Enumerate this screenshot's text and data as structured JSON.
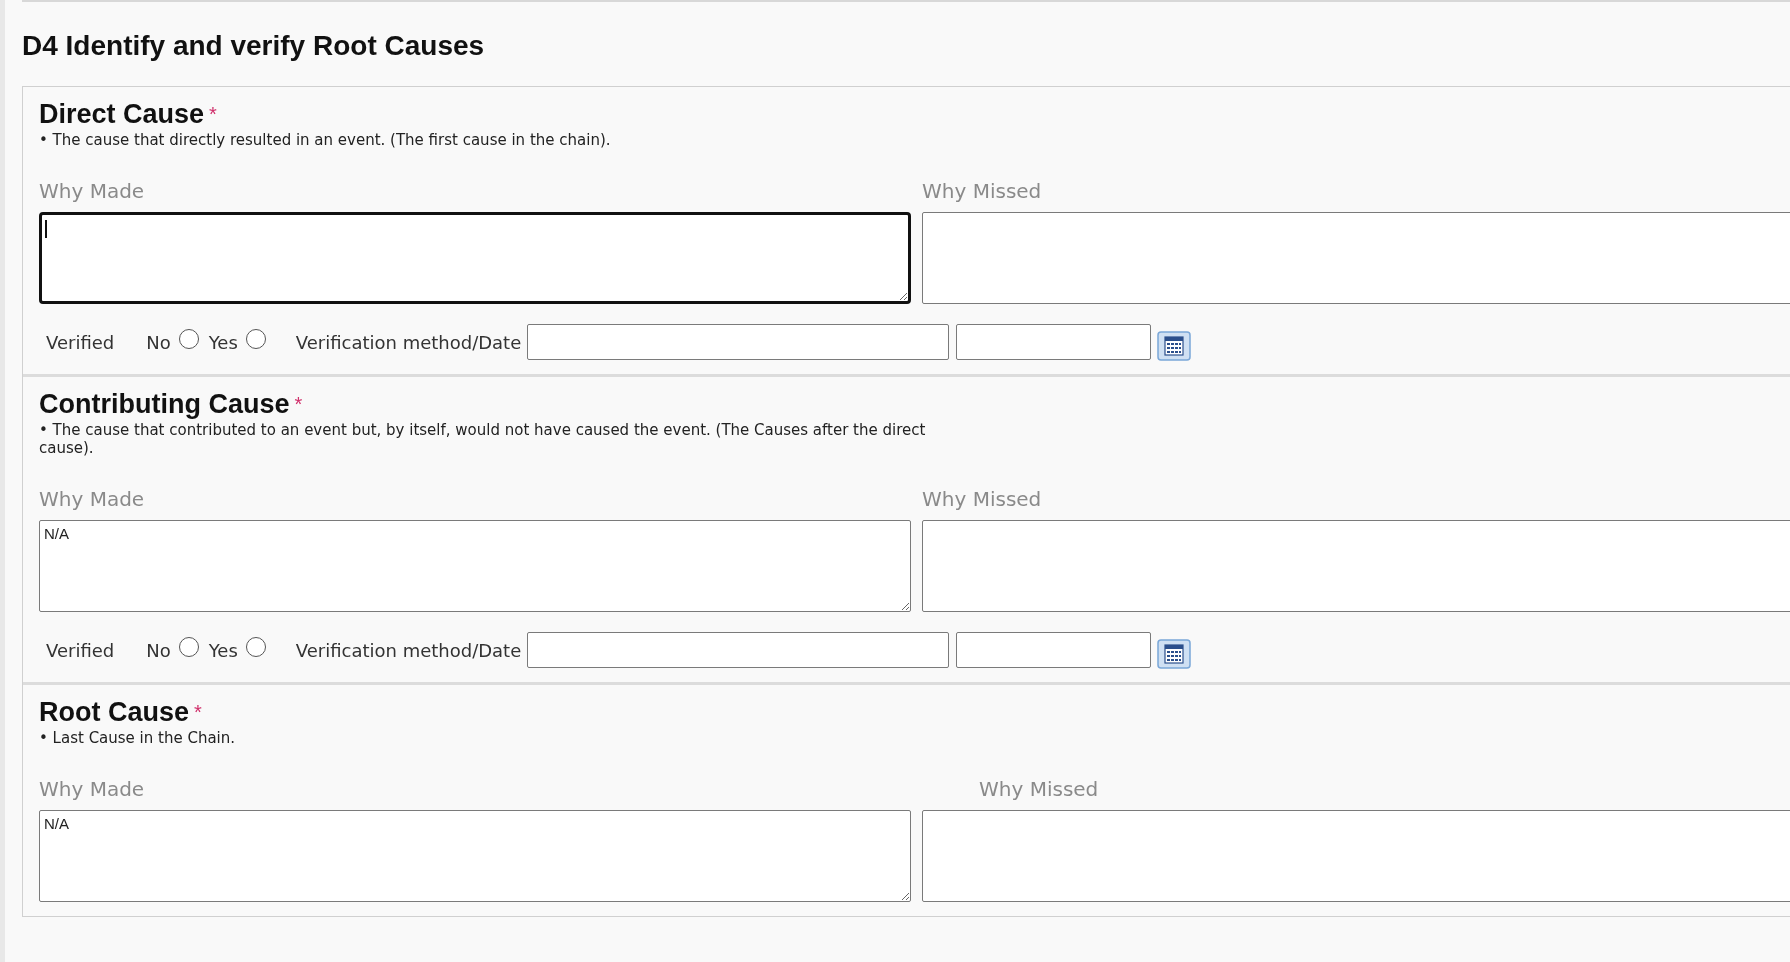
{
  "title": "D4 Identify and verify Root Causes",
  "sections": [
    {
      "heading": "Direct Cause",
      "required_mark": "*",
      "description": "• The cause that directly resulted in an event. (The first cause in the chain).",
      "fields": [
        {
          "label": "Why Made",
          "focused": true
        },
        {
          "label": "Why Missed",
          "focused": false
        }
      ],
      "verification": {
        "label": "Verified",
        "options": [
          {
            "label": "No",
            "checked": false
          },
          {
            "label": "Yes",
            "checked": false
          }
        ],
        "method_label": "Verification method/Date"
      }
    },
    {
      "heading": "Contributing Cause",
      "required_mark": "*",
      "description": "• The cause that contributed to an event but, by itself, would not have caused the event. (The Causes after the direct cause).",
      "fields": [
        {
          "label": "Why Made",
          "value": "N/A",
          "focused": false
        },
        {
          "label": "Why Missed",
          "focused": false
        }
      ],
      "verification": {
        "label": "Verified",
        "options": [
          {
            "label": "No",
            "checked": false
          },
          {
            "label": "Yes",
            "checked": false
          }
        ],
        "method_label": "Verification method/Date"
      }
    },
    {
      "heading": "Root Cause",
      "required_mark": "*",
      "description": "• Last Cause in the Chain.",
      "fields": [
        {
          "label": "Why Made",
          "value": "N/A",
          "focused": false
        },
        {
          "label": "Why Missed",
          "focused": false
        }
      ]
    }
  ]
}
